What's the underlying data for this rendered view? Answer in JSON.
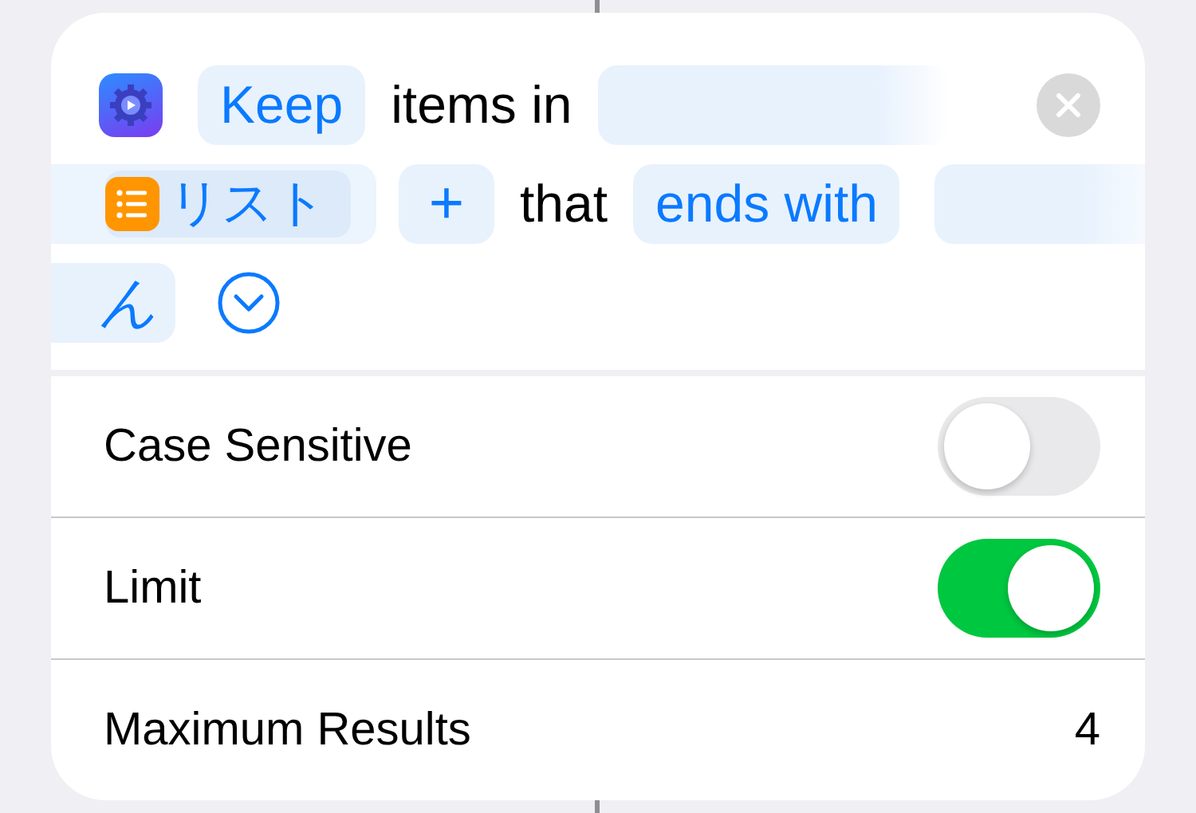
{
  "action": {
    "verb": "Keep",
    "text_1": "items in",
    "list_variable": "リスト",
    "add": "+",
    "text_2": "that",
    "condition": "ends with",
    "value": "ん"
  },
  "options": [
    {
      "kind": "toggle",
      "label": "Case Sensitive",
      "on": false
    },
    {
      "kind": "toggle",
      "label": "Limit",
      "on": true
    },
    {
      "kind": "value",
      "label": "Maximum Results",
      "value": "4"
    }
  ]
}
